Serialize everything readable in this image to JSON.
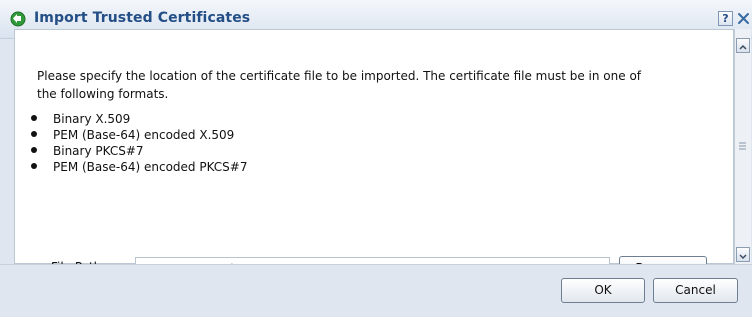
{
  "dialog": {
    "title": "Import Trusted Certificates",
    "help_label": "?",
    "close_icon": "close-icon",
    "title_icon": "import-arrow-icon"
  },
  "content": {
    "description": "Please specify the location of the certificate file to be imported. The certificate file must be in one of the following formats.",
    "formats": [
      "Binary X.509",
      "PEM (Base-64) encoded X.509",
      "Binary PKCS#7",
      "PEM (Base-64) encoded PKCS#7"
    ]
  },
  "file_path": {
    "label": "File Path::",
    "placeholder": "server_zentrale_cert.pem",
    "browse_label": "Browse..."
  },
  "footer": {
    "ok_label": "OK",
    "cancel_label": "Cancel"
  },
  "colors": {
    "title_text": "#234e86",
    "titlebar_bg": "#d9e3ef",
    "footer_bg": "#dfe6ef",
    "input_placeholder": "#9a9a9a"
  }
}
